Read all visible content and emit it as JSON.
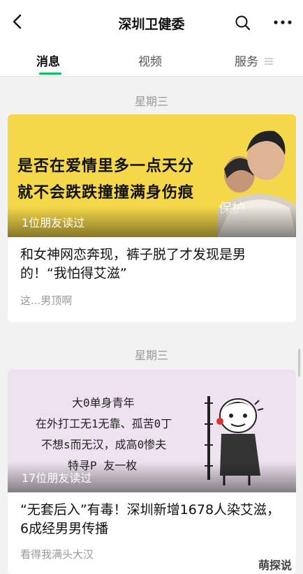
{
  "nav": {
    "title": "深圳卫健委"
  },
  "tabs": [
    {
      "label": "消息"
    },
    {
      "label": "视频"
    },
    {
      "label": "服务"
    }
  ],
  "feed": [
    {
      "date": "星期三",
      "cover_text": [
        "是否在爱情里多一点天分",
        "就不会跌跌撞撞满身伤痕"
      ],
      "cover_watermark": "保护",
      "friends_read": "1位朋友读过",
      "headline": "和女神网恋奔现，裤子脱了才发现是男的！“我怕得艾滋”",
      "digest": "这...男顶啊"
    },
    {
      "date": "星期三",
      "cover_text": [
        "大0单身青年",
        "在外打工无1无靠、孤苦0丁",
        "不想s而无汉，成高0惨夫",
        "特寻P  友一枚"
      ],
      "friends_read": "17位朋友读过",
      "headline": "“无套后入”有毒！深圳新增1678人染艾滋，6成经男男传播",
      "digest": "看得我满头大汉"
    }
  ],
  "watermark": "萌探说",
  "colors": {
    "accent": "#07c160",
    "cover1_bg": "#f4d84a",
    "cover2_bg": "#efe2f0"
  }
}
